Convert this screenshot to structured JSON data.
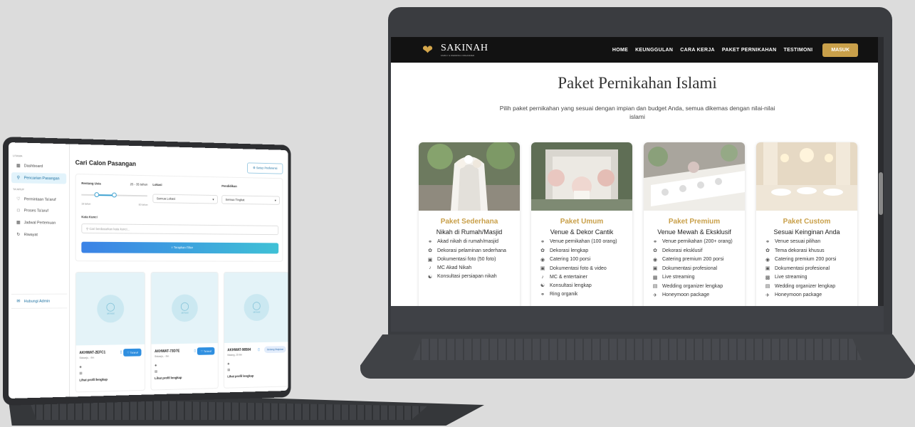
{
  "right_app": {
    "nav": {
      "brand": "SAKINAH",
      "brand_sub": "FAMILY & WEDDING ORGANIZER",
      "links": [
        "HOME",
        "KEUNGGULAN",
        "CARA KERJA",
        "PAKET PERNIKAHAN",
        "TESTIMONI"
      ],
      "login": "MASUK"
    },
    "hero": {
      "title": "Paket Pernikahan Islami",
      "subtitle": "Pilih paket pernikahan yang sesuai dengan impian dan budget Anda, semua dikemas dengan nilai-nilai islami"
    },
    "packages": [
      {
        "title": "Paket Sederhana",
        "subtitle": "Nikah di Rumah/Masjid",
        "features": [
          "Akad nikah di rumah/masjid",
          "Dekorasi pelaminan sederhana",
          "Dokumentasi foto (50 foto)",
          "MC Akad Nikah",
          "Konsultasi persiapan nikah"
        ]
      },
      {
        "title": "Paket Umum",
        "subtitle": "Venue & Dekor Cantik",
        "features": [
          "Venue pernikahan (100 orang)",
          "Dekorasi lengkap",
          "Catering 100 porsi",
          "Dokumentasi foto & video",
          "MC & entertainer",
          "Konsultasi lengkap",
          "Ring organik"
        ]
      },
      {
        "title": "Paket Premium",
        "subtitle": "Venue Mewah & Eksklusif",
        "features": [
          "Venue pernikahan (200+ orang)",
          "Dekorasi eksklusif",
          "Catering premium 200 porsi",
          "Dokumentasi profesional",
          "Live streaming",
          "Wedding organizer lengkap",
          "Honeymoon package"
        ]
      },
      {
        "title": "Paket Custom",
        "subtitle": "Sesuai Keinginan Anda",
        "features": [
          "Venue sesuai pilihan",
          "Tema dekorasi khusus",
          "Catering premium 200 porsi",
          "Dokumentasi profesional",
          "Live streaming",
          "Wedding organizer lengkap",
          "Honeymoon package"
        ]
      }
    ]
  },
  "left_app": {
    "sidebar": {
      "section_main": "UTAMA",
      "items_main": [
        {
          "label": "Dashboard",
          "icon": "grid-icon"
        },
        {
          "label": "Pencarian Pasangan",
          "icon": "search-icon"
        }
      ],
      "section_taaruf": "TA'ARUF",
      "items_taaruf": [
        {
          "label": "Permintaan Ta'aruf",
          "icon": "heart-icon"
        },
        {
          "label": "Proses Ta'aruf",
          "icon": "chat-icon"
        },
        {
          "label": "Jadwal Pertemuan",
          "icon": "calendar-icon"
        },
        {
          "label": "Riwayat",
          "icon": "history-icon"
        }
      ],
      "admin": "Hubungi Admin"
    },
    "main": {
      "title": "Cari Calon Pasangan",
      "pref_button": "Setup Preferensi",
      "filter": {
        "age_label": "Rentang Usia",
        "age_value": "25 - 35 tahun",
        "age_min": "18 tahun",
        "age_max": "60 tahun",
        "location_label": "Lokasi",
        "location_value": "Semua Lokasi",
        "education_label": "Pendidikan",
        "education_value": "Semua Tingkat",
        "keyword_label": "Kata Kunci",
        "keyword_placeholder": "Cari berdasarkan kata kunci...",
        "apply": "Terapkan Filter"
      },
      "profiles": [
        {
          "code": "AKHWAT-2EFC1",
          "location": "Sidoarjo, - thn",
          "action": "Ta'aruf",
          "link": "Lihat profil lengkap",
          "badge": "akhwat"
        },
        {
          "code": "AKHWAT-73D7E",
          "location": "Sidoarjo, - thn",
          "action": "Ta'aruf",
          "link": "Lihat profil lengkap",
          "badge": "akhwat"
        },
        {
          "code": "AKHWAT-98584",
          "location": "Malang, 25 thn",
          "action": "Sedang Diajukan",
          "link": "Lihat profil lengkap",
          "badge": "akhwat"
        }
      ]
    }
  }
}
